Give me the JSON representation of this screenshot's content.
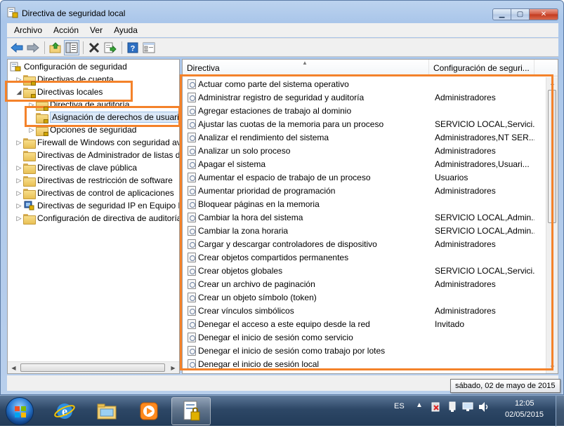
{
  "window": {
    "title": "Directiva de seguridad local"
  },
  "menu": [
    "Archivo",
    "Acción",
    "Ver",
    "Ayuda"
  ],
  "toolbar": {
    "icons": [
      "back-arrow-icon",
      "forward-arrow-icon",
      "up-folder-icon",
      "show-hide-tree-icon",
      "delete-icon",
      "export-list-icon",
      "help-icon",
      "properties-icon"
    ]
  },
  "tree": [
    {
      "label": "Configuración de seguridad",
      "level": 0,
      "expander": "",
      "icon": "shield"
    },
    {
      "label": "Directivas de cuenta",
      "level": 1,
      "expander": "▷",
      "icon": "folder"
    },
    {
      "label": "Directivas locales",
      "level": 1,
      "expander": "◢",
      "icon": "folder"
    },
    {
      "label": "Directiva de auditoría",
      "level": 2,
      "expander": "▷",
      "icon": "folder"
    },
    {
      "label": "Asignación de derechos de usuario",
      "level": 2,
      "expander": "",
      "icon": "folder",
      "selected": true
    },
    {
      "label": "Opciones de seguridad",
      "level": 2,
      "expander": "▷",
      "icon": "folder"
    },
    {
      "label": "Firewall de Windows con seguridad avanzada",
      "level": 1,
      "expander": "▷",
      "icon": "folder"
    },
    {
      "label": "Directivas de Administrador de listas de redes",
      "level": 1,
      "expander": "",
      "icon": "folder"
    },
    {
      "label": "Directivas de clave pública",
      "level": 1,
      "expander": "▷",
      "icon": "folder"
    },
    {
      "label": "Directivas de restricción de software",
      "level": 1,
      "expander": "▷",
      "icon": "folder"
    },
    {
      "label": "Directivas de control de aplicaciones",
      "level": 1,
      "expander": "▷",
      "icon": "folder"
    },
    {
      "label": "Directivas de seguridad IP en Equipo local",
      "level": 1,
      "expander": "▷",
      "icon": "shield"
    },
    {
      "label": "Configuración de directiva de auditoría avanzada",
      "level": 1,
      "expander": "▷",
      "icon": "folder"
    }
  ],
  "list": {
    "columns": [
      "Directiva",
      "Configuración de seguri..."
    ],
    "rows": [
      {
        "name": "Actuar como parte del sistema operativo",
        "value": ""
      },
      {
        "name": "Administrar registro de seguridad y auditoría",
        "value": "Administradores"
      },
      {
        "name": "Agregar estaciones de trabajo al dominio",
        "value": ""
      },
      {
        "name": "Ajustar las cuotas de la memoria para un proceso",
        "value": "SERVICIO LOCAL,Servici..."
      },
      {
        "name": "Analizar el rendimiento del sistema",
        "value": "Administradores,NT SER..."
      },
      {
        "name": "Analizar un solo proceso",
        "value": "Administradores"
      },
      {
        "name": "Apagar el sistema",
        "value": "Administradores,Usuari..."
      },
      {
        "name": "Aumentar el espacio de trabajo de un proceso",
        "value": "Usuarios"
      },
      {
        "name": "Aumentar prioridad de programación",
        "value": "Administradores"
      },
      {
        "name": "Bloquear páginas en la memoria",
        "value": ""
      },
      {
        "name": "Cambiar la hora del sistema",
        "value": "SERVICIO LOCAL,Admin..."
      },
      {
        "name": "Cambiar la zona horaria",
        "value": "SERVICIO LOCAL,Admin..."
      },
      {
        "name": "Cargar y descargar controladores de dispositivo",
        "value": "Administradores"
      },
      {
        "name": "Crear objetos compartidos permanentes",
        "value": ""
      },
      {
        "name": "Crear objetos globales",
        "value": "SERVICIO LOCAL,Servici..."
      },
      {
        "name": "Crear un archivo de paginación",
        "value": "Administradores"
      },
      {
        "name": "Crear un objeto símbolo (token)",
        "value": ""
      },
      {
        "name": "Crear vínculos simbólicos",
        "value": "Administradores"
      },
      {
        "name": "Denegar el acceso a este equipo desde la red",
        "value": "Invitado"
      },
      {
        "name": "Denegar el inicio de sesión como servicio",
        "value": ""
      },
      {
        "name": "Denegar el inicio de sesión como trabajo por lotes",
        "value": ""
      },
      {
        "name": "Denegar el inicio de sesión local",
        "value": ""
      }
    ]
  },
  "taskbar": {
    "language": "ES",
    "time": "12:05",
    "date": "02/05/2015",
    "tooltip": "sábado, 02 de mayo de 2015",
    "apps": [
      "internet-explorer-icon",
      "file-explorer-icon",
      "media-player-icon",
      "security-policy-icon"
    ]
  },
  "colors": {
    "highlight": "#f4822a",
    "selection": "#dbe8f7"
  }
}
